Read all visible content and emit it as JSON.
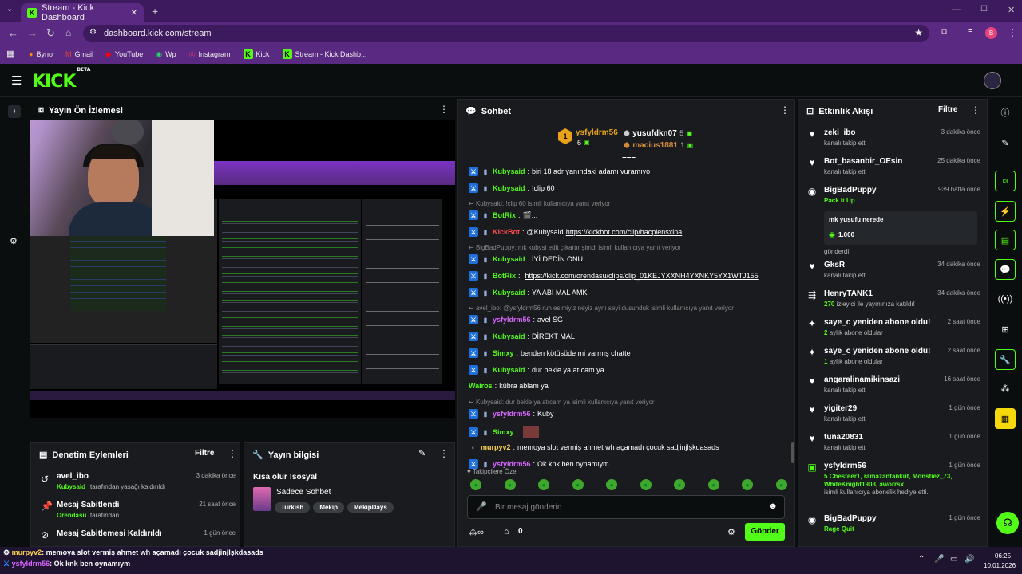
{
  "browser": {
    "tab_title": "Stream - Kick Dashboard",
    "url": "dashboard.kick.com/stream",
    "bookmarks": [
      "Byno",
      "Gmail",
      "YouTube",
      "Wp",
      "Instagram",
      "Kick",
      "Stream - Kick Dashb..."
    ],
    "profile_initial": "B"
  },
  "app": {
    "logo": "KICK",
    "logo_sup": "BETA"
  },
  "preview": {
    "title": "Yayın Ön İzlemesi"
  },
  "mod_actions": {
    "title": "Denetim Eylemleri",
    "filter": "Filtre",
    "items": [
      {
        "title": "avel_ibo",
        "sub_user": "Kubysaid",
        "sub_text": "tarafından yasağı kaldırıldı",
        "time": "3 dakika önce"
      },
      {
        "title": "Mesaj Sabitlendi",
        "sub_user": "Orendasu",
        "sub_text": "tarafından",
        "time": "21 saat önce"
      },
      {
        "title": "Mesaj Sabitlemesi Kaldırıldı",
        "sub_user": "",
        "sub_text": "",
        "time": "1 gün önce"
      }
    ]
  },
  "stream_info": {
    "title": "Yayın bilgisi",
    "stream_title": "Kısa olur !sosyal",
    "category": "Sadece Sohbet",
    "tags": [
      "Turkish",
      "Mekip",
      "MekipDays"
    ]
  },
  "chat": {
    "title": "Sohbet",
    "top_gifters": [
      {
        "name": "ysfyldrm56",
        "count": "6"
      },
      {
        "name": "yusufdkn07",
        "count": "5"
      },
      {
        "name": "macius1881",
        "count": "1"
      }
    ],
    "messages": [
      {
        "user": "Kubysaid",
        "color": "#53fc18",
        "text": "biri 18 adr yanındaki adamı vuramıyo"
      },
      {
        "user": "Kubysaid",
        "color": "#53fc18",
        "text": "!clip 60"
      },
      {
        "reply": "Kubysaid: !clip 60 isimli kullanıcıya yanıt veriyor"
      },
      {
        "user": "BotRix",
        "color": "#53fc18",
        "text": "🎬..."
      },
      {
        "user": "KickBot",
        "color": "#ff4b4b",
        "text": "@Kubysaid ",
        "link": "https://kickbot.com/clip/hacplensxlna"
      },
      {
        "reply": "BigBadPuppy: mk kubysi edit çıkartır şimdi isimli kullanıcıya yanıt veriyor"
      },
      {
        "user": "Kubysaid",
        "color": "#53fc18",
        "text": "İYİ DEDİN ONU"
      },
      {
        "user": "BotRix",
        "color": "#53fc18",
        "text": "",
        "link": "https://kick.com/orendasu/clips/clip_01KEJYXXNH4YXNKY5YX1WTJ155"
      },
      {
        "user": "Kubysaid",
        "color": "#53fc18",
        "text": "YA ABİ MAL AMK"
      },
      {
        "reply": "avel_ibo: @ysfyldrm56 ruh esimiyiz neyiz aynı seyi dusunduk isimli kullanıcıya yanıt veriyor"
      },
      {
        "user": "ysfyldrm56",
        "color": "#d966ff",
        "text": "avel SG"
      },
      {
        "user": "Kubysaid",
        "color": "#53fc18",
        "text": "DİREKT MAL"
      },
      {
        "user": "Simxy",
        "color": "#53fc18",
        "text": "benden kötüsüde mi varmış chatte"
      },
      {
        "user": "Kubysaid",
        "color": "#53fc18",
        "text": "dur bekle ya atıcam ya"
      },
      {
        "user": "Wairos",
        "color": "#53fc18",
        "text": "kübra ablam ya"
      },
      {
        "reply": "Kubysaid: dur bekle ya atıcam ya isimli kullanıcıya yanıt veriyor"
      },
      {
        "user": "ysfyldrm56",
        "color": "#d966ff",
        "text": "Kuby"
      },
      {
        "user": "Simxy",
        "color": "#53fc18",
        "text": ""
      },
      {
        "user": "murpyv2",
        "color": "#ffd54a",
        "text": "memoya slot vermiş ahmet wh açamadı çocuk sadjinjlşkdasads"
      },
      {
        "user": "ysfyldrm56",
        "color": "#d966ff",
        "text": "Ok knk ben oynamıym"
      }
    ],
    "followers_label": "Takipçilere Özel",
    "input_placeholder": "Bir mesaj gönderin",
    "points": "0",
    "send": "Gönder"
  },
  "activity": {
    "title": "Etkinlik Akışı",
    "filter": "Filtre",
    "events": [
      {
        "icon": "heart-icon",
        "name": "zeki_ibo",
        "sub": "kanalı takip etti",
        "time": "3 dakika önce"
      },
      {
        "icon": "heart-icon",
        "name": "Bot_basanbir_OEsin",
        "sub": "kanalı takip etti",
        "time": "25 dakika önce"
      },
      {
        "icon": "kick-coin-icon",
        "name": "BigBadPuppy",
        "sub": "Pack It Up",
        "time": "939 hafta önce",
        "msg": "mk yusufu nerede",
        "amount": "1.000",
        "after": "gönderdi"
      },
      {
        "icon": "heart-icon",
        "name": "GksR",
        "sub": "kanalı takip etti",
        "time": "34 dakika önce"
      },
      {
        "icon": "raid-icon",
        "name": "HenryTANK1",
        "sub_num": "270",
        "sub": "izleyici ile yayınınıza katıldı!",
        "time": "34 dakika önce"
      },
      {
        "icon": "sparkle-icon",
        "name": "saye_c yeniden abone oldu!",
        "sub_num": "2",
        "sub": "aylık abone oldular",
        "time": "2 saat önce"
      },
      {
        "icon": "sparkle-icon",
        "name": "saye_c yeniden abone oldu!",
        "sub_num": "1",
        "sub": "aylık abone oldular",
        "time": "2 saat önce"
      },
      {
        "icon": "heart-icon",
        "name": "angaralinamikinsazi",
        "sub": "kanalı takip etti",
        "time": "16 saat önce"
      },
      {
        "icon": "heart-icon",
        "name": "yigiter29",
        "sub": "kanalı takip etti",
        "time": "1 gün önce"
      },
      {
        "icon": "heart-icon",
        "name": "tuna20831",
        "sub": "kanalı takip etti",
        "time": "1 gün önce"
      },
      {
        "icon": "gift-icon",
        "name": "ysfyldrm56",
        "sub_num": "5",
        "sub": "Chesteer1, ramazantankut, Monstiez_73, WhiteKnight1903, aworrsx",
        "sub2": "isimli kullanıcıya abonelik hediye etti.",
        "time": "1 gün önce"
      },
      {
        "icon": "kick-coin-icon",
        "name": "BigBadPuppy",
        "sub": "Rage Quit",
        "time": "1 gün önce"
      }
    ]
  },
  "taskbar": {
    "ticker1_user": "murpyv2",
    "ticker1_text": ": memoya slot vermiş ahmet wh açamadı çocuk sadjinjlşkdasads",
    "ticker2_user": "ysfyldrm56",
    "ticker2_text": ": Ok knk ben oynamıym",
    "time": "06:25",
    "date": "10.01.2026"
  }
}
